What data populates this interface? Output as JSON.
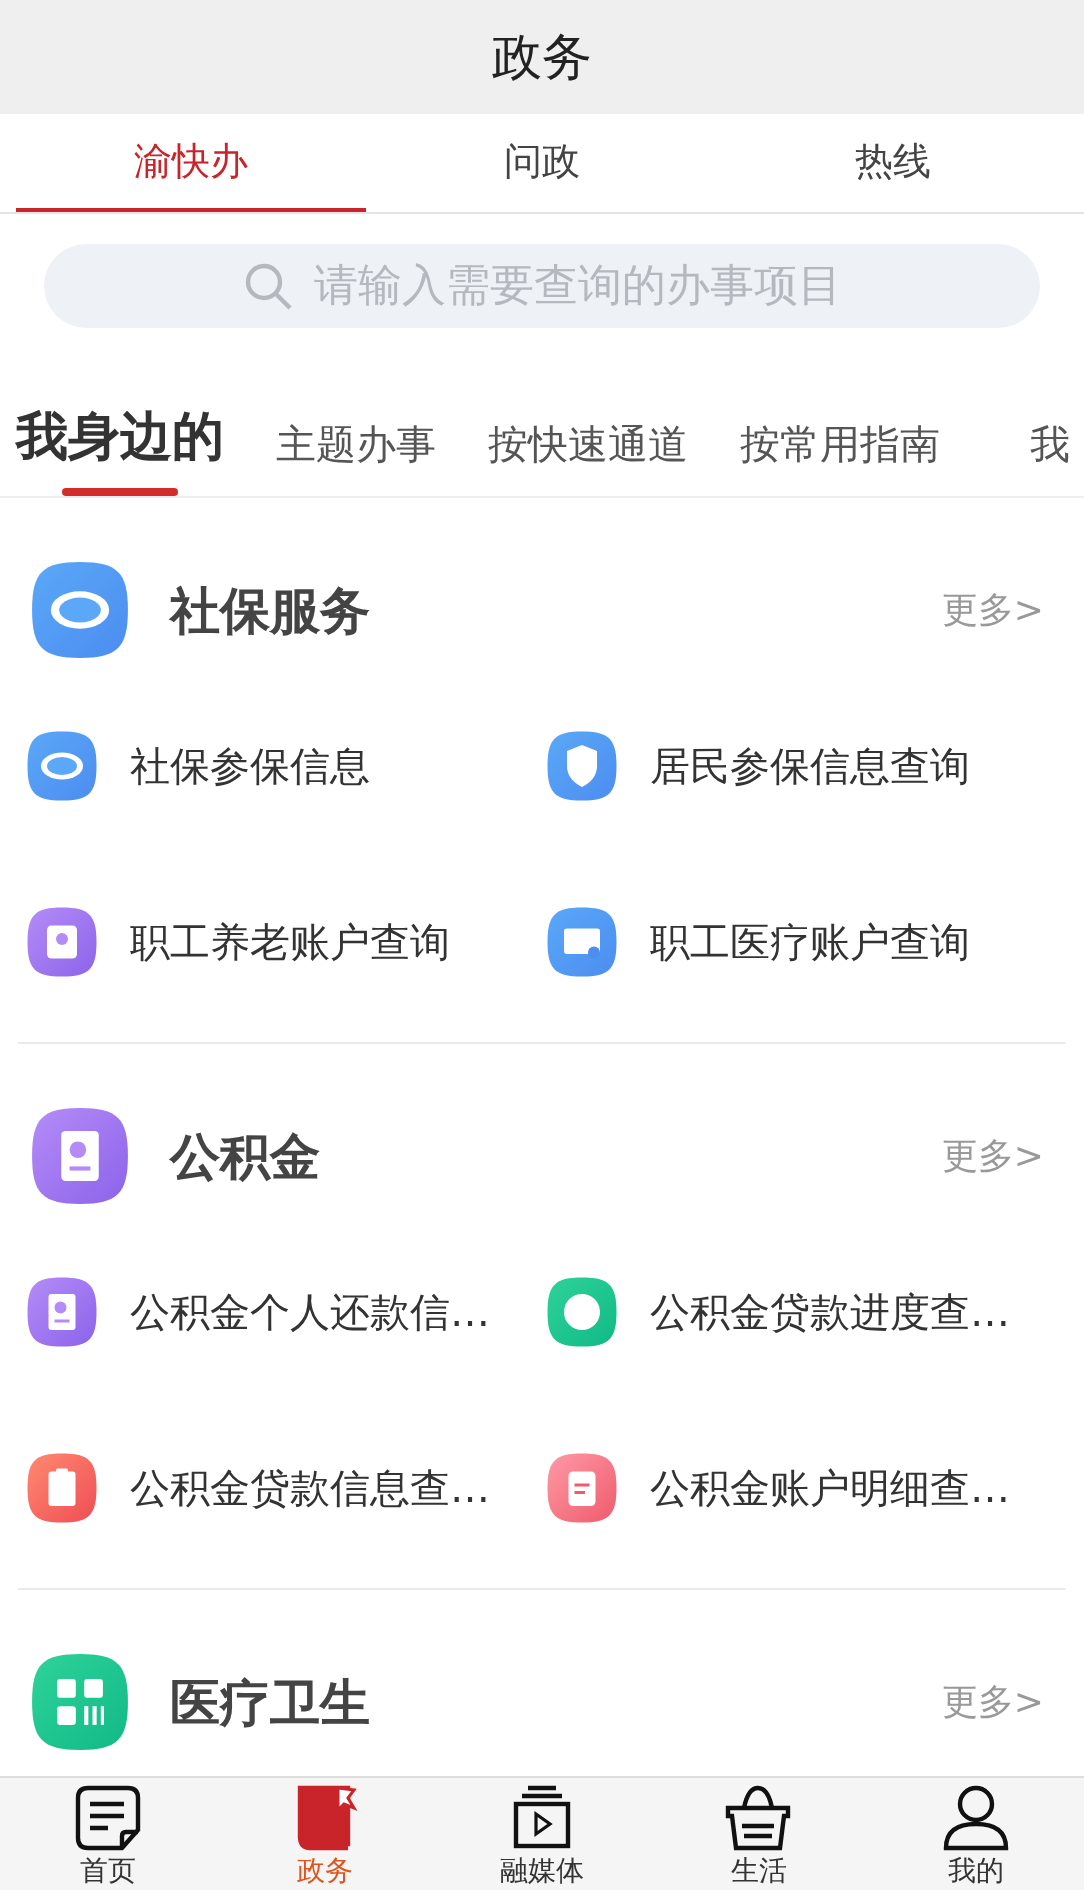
{
  "header": {
    "title": "政务"
  },
  "tabs": [
    {
      "label": "渝快办",
      "selected": true
    },
    {
      "label": "问政",
      "selected": false
    },
    {
      "label": "热线",
      "selected": false
    }
  ],
  "search": {
    "placeholder": "请输入需要查询的办事项目"
  },
  "categories": [
    {
      "label": "我身边的",
      "selected": true
    },
    {
      "label": "主题办事",
      "selected": false
    },
    {
      "label": "按快速通道",
      "selected": false
    },
    {
      "label": "按常用指南",
      "selected": false
    },
    {
      "label": "我",
      "selected": false
    }
  ],
  "sections": [
    {
      "title": "社保服务",
      "kind": "badge",
      "more": "更多>",
      "items": [
        {
          "label": "社保参保信息",
          "kind": "badge"
        },
        {
          "label": "居民参保信息查询",
          "kind": "shield"
        },
        {
          "label": "职工养老账户查询",
          "kind": "card"
        },
        {
          "label": "职工医疗账户查询",
          "kind": "id"
        }
      ]
    },
    {
      "title": "公积金",
      "kind": "doc",
      "more": "更多>",
      "items": [
        {
          "label": "公积金个人还款信…",
          "kind": "doc"
        },
        {
          "label": "公积金贷款进度查…",
          "kind": "coin"
        },
        {
          "label": "公积金贷款信息查…",
          "kind": "clip"
        },
        {
          "label": "公积金账户明细查…",
          "kind": "list"
        }
      ]
    },
    {
      "title": "医疗卫生",
      "kind": "grid",
      "more": "更多>"
    }
  ],
  "nav": [
    {
      "label": "首页",
      "kind": "note",
      "selected": false
    },
    {
      "label": "政务",
      "kind": "book",
      "selected": true
    },
    {
      "label": "融媒体",
      "kind": "tv",
      "selected": false
    },
    {
      "label": "生活",
      "kind": "basket",
      "selected": false
    },
    {
      "label": "我的",
      "kind": "user",
      "selected": false
    }
  ]
}
